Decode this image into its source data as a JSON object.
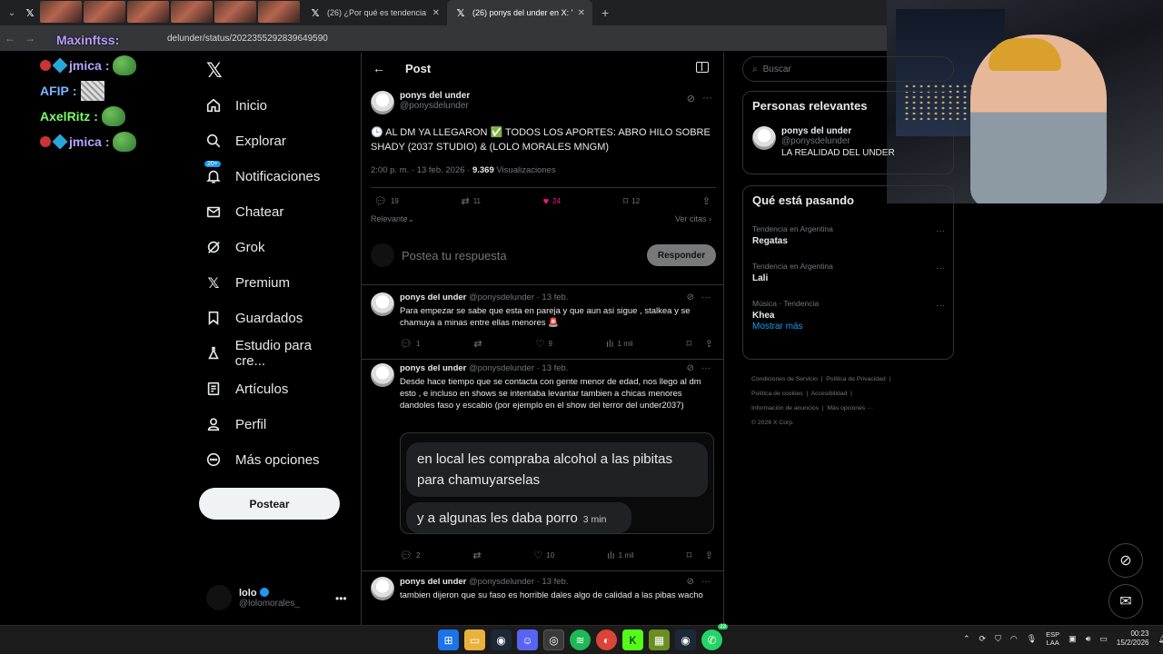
{
  "browser": {
    "tabs": [
      {
        "label": "(26) ¿Por qué es tendencia? en",
        "active": false
      },
      {
        "label": "(26) ponys del under en X: \"",
        "active": true
      }
    ],
    "url": "delunder/status/2022355292839649590"
  },
  "overlay_chat": [
    {
      "name": "jmica",
      "badges": true,
      "emote": "pepe"
    },
    {
      "name": "AFIP",
      "badges": false,
      "emote": "afip"
    },
    {
      "name": "AxelRitz",
      "badges": false,
      "emote": "pepe"
    },
    {
      "name": "jmica",
      "badges": true,
      "emote": "pepe"
    }
  ],
  "overlay_top_name": "Maxinftss:",
  "nav": {
    "items": [
      {
        "label": "Inicio",
        "icon": "home-icon"
      },
      {
        "label": "Explorar",
        "icon": "search-icon"
      },
      {
        "label": "Notificaciones",
        "icon": "bell-icon",
        "badge": "20+"
      },
      {
        "label": "Chatear",
        "icon": "mail-icon"
      },
      {
        "label": "Grok",
        "icon": "grok-icon"
      },
      {
        "label": "Premium",
        "icon": "x-logo-icon"
      },
      {
        "label": "Guardados",
        "icon": "bookmark-icon"
      },
      {
        "label": "Estudio para cre...",
        "icon": "flask-icon"
      },
      {
        "label": "Artículos",
        "icon": "article-icon"
      },
      {
        "label": "Perfil",
        "icon": "person-icon"
      },
      {
        "label": "Más opciones",
        "icon": "more-circle-icon"
      }
    ],
    "post_button": "Postear",
    "account": {
      "name": "lolo",
      "handle": "@lolomorales_"
    }
  },
  "main": {
    "header_title": "Post",
    "tweet": {
      "name": "ponys del under",
      "handle": "@ponysdelunder",
      "text": "🕒 AL DM YA LLEGARON ✅ TODOS LOS APORTES: ABRO HILO SOBRE SHADY (2037 STUDIO) & (LOLO MORALES MNGM)",
      "time": "2:00 p. m. · 13 feb. 2026 · ",
      "views": "9.369",
      "views_label": " Visualizaciones",
      "replies": "19",
      "reposts": "11",
      "likes": "24",
      "bookmarks": "12"
    },
    "sort_label": "Relevante",
    "quotes_label": "Ver citas",
    "reply_placeholder": "Postea tu respuesta",
    "reply_button": "Responder",
    "replies": [
      {
        "name": "ponys del under",
        "meta": " @ponysdelunder · 13 feb.",
        "text": "Para empezar se sabe que esta en pareja y que aun asi sigue , stalkea y se chamuya a minas entre ellas menores 🚨",
        "replies": "1",
        "reposts": "",
        "likes": "9",
        "views": "1 mil"
      },
      {
        "name": "ponys del under",
        "meta": " @ponysdelunder · 13 feb.",
        "text": "Desde hace tiempo que se contacta con gente menor de edad, nos llego al dm esto , e incluso en shows se intentaba levantar tambien a chicas menores dandoles faso y escabio (por ejemplo en el show del terror del under2037)",
        "replies": "2",
        "reposts": "",
        "likes": "10",
        "views": "1 mil",
        "embed": {
          "bubble1": "en local les compraba alcohol a las pibitas para chamuyarselas",
          "bubble2": "y a algunas les daba porro",
          "bubble2_time": "3 min"
        }
      },
      {
        "name": "ponys del under",
        "meta": " @ponysdelunder · 13 feb.",
        "text": "tambien dijeron que su faso es horrible dales algo de calidad a las pibas wacho"
      }
    ]
  },
  "right": {
    "search_placeholder": "Buscar",
    "relevant_title": "Personas relevantes",
    "relevant_user": {
      "name": "ponys del under",
      "handle": "@ponysdelunder",
      "bio": "LA REALIDAD DEL UNDER"
    },
    "trends_title": "Qué está pasando",
    "trends": [
      {
        "context": "Tendencia en Argentina",
        "name": "Regatas"
      },
      {
        "context": "Tendencia en Argentina",
        "name": "Lali"
      },
      {
        "context": "Música · Tendencia",
        "name": "Khea"
      }
    ],
    "show_more": "Mostrar más",
    "footer": [
      "Condiciones de Servicio",
      "Política de Privacidad",
      "Política de cookies",
      "Accesibilidad",
      "Información de anuncios",
      "Más opciones ···",
      "© 2026 X Corp."
    ]
  },
  "taskbar": {
    "lang_top": "ESP",
    "lang_bottom": "LAA",
    "time": "00:23",
    "date": "15/2/2026",
    "whatsapp_badge": "23"
  },
  "colors": {
    "accent": "#1d9bf0",
    "like": "#f91880",
    "bg": "#000000"
  }
}
